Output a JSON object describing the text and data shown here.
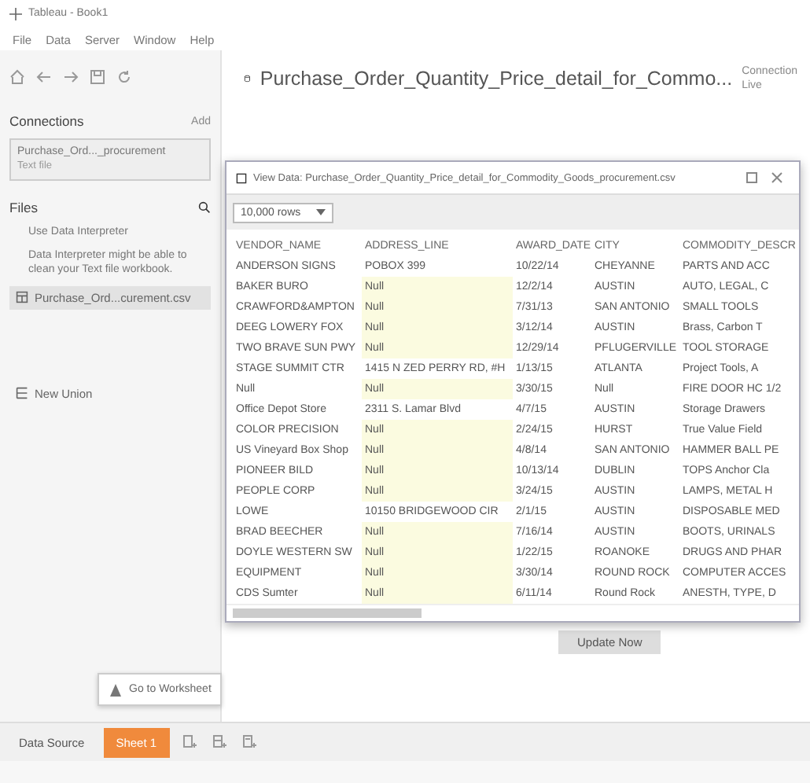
{
  "window": {
    "title": "Tableau - Book1"
  },
  "menu": [
    "File",
    "Data",
    "Server",
    "Window",
    "Help"
  ],
  "connections": {
    "title": "Connections",
    "add": "Add",
    "item": {
      "name": "Purchase_Ord..._procurement",
      "type": "Text file"
    }
  },
  "files": {
    "title": "Files",
    "interpreter": "Use Data Interpreter",
    "interpreter_hint": "Data Interpreter might be able to clean your Text file workbook.",
    "items": [
      {
        "name": "Purchase_Ord...curement.csv",
        "selected": true
      }
    ],
    "new_union": "New Union"
  },
  "header": {
    "title": "Purchase_Order_Quantity_Price_detail_for_Commo...",
    "connection_label": "Connection",
    "connection_mode": "Live"
  },
  "update_button": "Update Now",
  "dialog": {
    "title": "View Data: Purchase_Order_Quantity_Price_detail_for_Commodity_Goods_procurement.csv",
    "rows_select": "10,000 rows",
    "columns": [
      "VENDOR_NAME",
      "ADDRESS_LINE",
      "AWARD_DATE",
      "CITY",
      "COMMODITY_DESCR"
    ],
    "rows": [
      {
        "cells": [
          "ANDERSON SIGNS",
          "POBOX 399",
          "10/22/14",
          "CHEYANNE",
          "PARTS AND ACC"
        ],
        "address_null": false
      },
      {
        "cells": [
          "BAKER BURO",
          "Null",
          "12/2/14",
          "AUSTIN",
          "AUTO, LEGAL, C"
        ],
        "address_null": true
      },
      {
        "cells": [
          "CRAWFORD&AMPTON",
          "Null",
          "7/31/13",
          "SAN ANTONIO",
          "SMALL TOOLS"
        ],
        "address_null": true
      },
      {
        "cells": [
          "DEEG LOWERY FOX",
          "Null",
          "3/12/14",
          "AUSTIN",
          "Brass, Carbon T"
        ],
        "address_null": true
      },
      {
        "cells": [
          "TWO BRAVE SUN PWY",
          "Null",
          "12/29/14",
          "PFLUGERVILLE",
          "TOOL STORAGE"
        ],
        "address_null": true
      },
      {
        "cells": [
          "STAGE SUMMIT CTR",
          "1415 N ZED PERRY RD, #H",
          "1/13/15",
          "ATLANTA",
          "Project Tools, A"
        ],
        "address_null": false
      },
      {
        "cells": [
          "Null",
          "Null",
          "3/30/15",
          "Null",
          "FIRE DOOR HC 1/2"
        ],
        "address_null": true
      },
      {
        "cells": [
          "Office Depot Store",
          "2311 S. Lamar Blvd",
          "4/7/15",
          "AUSTIN",
          "Storage Drawers"
        ],
        "address_null": false
      },
      {
        "cells": [
          "COLOR PRECISION",
          "Null",
          "2/24/15",
          "HURST",
          "True Value Field"
        ],
        "address_null": true
      },
      {
        "cells": [
          "US Vineyard Box Shop",
          "Null",
          "4/8/14",
          "SAN ANTONIO",
          "HAMMER BALL PE"
        ],
        "address_null": true
      },
      {
        "cells": [
          "PIONEER BILD",
          "Null",
          "10/13/14",
          "DUBLIN",
          "TOPS Anchor Cla"
        ],
        "address_null": true
      },
      {
        "cells": [
          "PEOPLE CORP",
          "Null",
          "3/24/15",
          "AUSTIN",
          "LAMPS, METAL H"
        ],
        "address_null": true
      },
      {
        "cells": [
          "LOWE",
          "10150 BRIDGEWOOD CIR",
          "2/1/15",
          "AUSTIN",
          "DISPOSABLE MED"
        ],
        "address_null": false
      },
      {
        "cells": [
          "BRAD BEECHER",
          "Null",
          "7/16/14",
          "AUSTIN",
          "BOOTS, URINALS"
        ],
        "address_null": true
      },
      {
        "cells": [
          "DOYLE WESTERN SW",
          "Null",
          "1/22/15",
          "ROANOKE",
          "DRUGS AND PHAR"
        ],
        "address_null": true
      },
      {
        "cells": [
          "EQUIPMENT",
          "Null",
          "3/30/14",
          "ROUND ROCK",
          "COMPUTER ACCES"
        ],
        "address_null": true
      },
      {
        "cells": [
          "CDS Sumter",
          "Null",
          "6/11/14",
          "Round Rock",
          "ANESTH, TYPE, D"
        ],
        "address_null": true
      }
    ]
  },
  "go_to_worksheet": "Go to Worksheet",
  "tabs": [
    {
      "label": "Data Source",
      "selected": false,
      "kind": "text"
    },
    {
      "label": "Sheet 1",
      "selected": true,
      "kind": "sheet"
    },
    {
      "kind": "new-sheet",
      "selected": false
    },
    {
      "kind": "new-dashboard",
      "selected": false
    },
    {
      "kind": "new-story",
      "selected": false
    }
  ]
}
